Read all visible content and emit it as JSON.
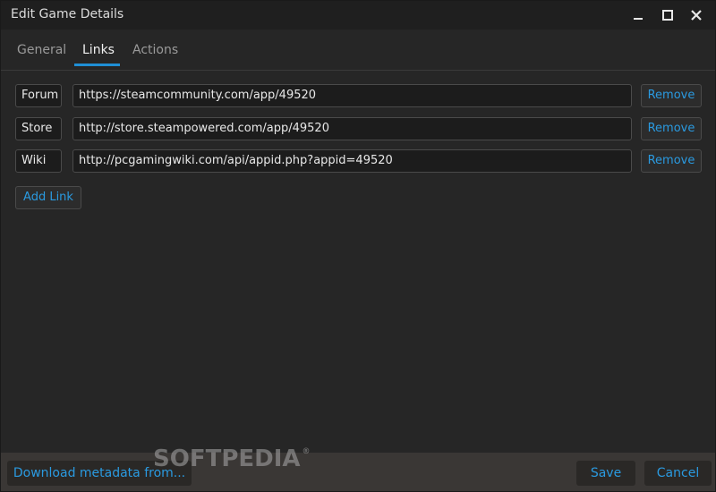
{
  "window": {
    "title": "Edit Game Details"
  },
  "tabs": [
    {
      "label": "General"
    },
    {
      "label": "Links"
    },
    {
      "label": "Actions"
    }
  ],
  "active_tab": "Links",
  "links": [
    {
      "name": "Forum",
      "url": "https://steamcommunity.com/app/49520",
      "remove_label": "Remove"
    },
    {
      "name": "Store",
      "url": "http://store.steampowered.com/app/49520",
      "remove_label": "Remove"
    },
    {
      "name": "Wiki",
      "url": "http://pcgamingwiki.com/api/appid.php?appid=49520",
      "remove_label": "Remove"
    }
  ],
  "add_link_label": "Add Link",
  "footer": {
    "download_label": "Download metadata from...",
    "save_label": "Save",
    "cancel_label": "Cancel"
  },
  "watermark": {
    "text": "SOFTPEDIA",
    "mark": "®"
  },
  "colors": {
    "accent": "#1f8fd6",
    "link_text": "#2a9ae0",
    "background": "#262626",
    "footer_bg": "#3a3735"
  },
  "icons": [
    "minimize-icon",
    "maximize-icon",
    "close-icon"
  ]
}
